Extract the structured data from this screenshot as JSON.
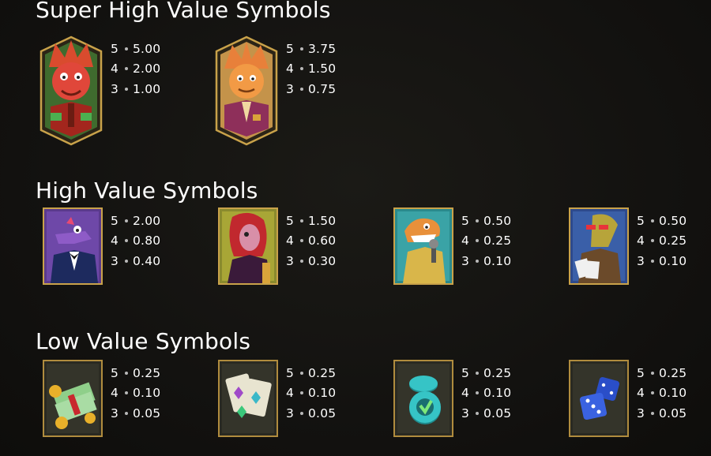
{
  "sections": {
    "super_high": {
      "title": "Super High Value Symbols",
      "symbols": [
        {
          "art": "red-triceratops-boss-symbol",
          "pays": [
            {
              "count": "5",
              "value": "5.00"
            },
            {
              "count": "4",
              "value": "2.00"
            },
            {
              "count": "3",
              "value": "1.00"
            }
          ]
        },
        {
          "art": "orange-triceratops-suit-symbol",
          "pays": [
            {
              "count": "5",
              "value": "3.75"
            },
            {
              "count": "4",
              "value": "1.50"
            },
            {
              "count": "3",
              "value": "0.75"
            }
          ]
        }
      ]
    },
    "high": {
      "title": "High Value Symbols",
      "symbols": [
        {
          "art": "purple-crocodile-tuxedo-symbol",
          "pays": [
            {
              "count": "5",
              "value": "2.00"
            },
            {
              "count": "4",
              "value": "0.80"
            },
            {
              "count": "3",
              "value": "0.40"
            }
          ]
        },
        {
          "art": "redhead-lady-dino-symbol",
          "pays": [
            {
              "count": "5",
              "value": "1.50"
            },
            {
              "count": "4",
              "value": "0.60"
            },
            {
              "count": "3",
              "value": "0.30"
            }
          ]
        },
        {
          "art": "singer-dino-microphone-symbol",
          "pays": [
            {
              "count": "5",
              "value": "0.50"
            },
            {
              "count": "4",
              "value": "0.25"
            },
            {
              "count": "3",
              "value": "0.10"
            }
          ]
        },
        {
          "art": "green-dino-cards-symbol",
          "pays": [
            {
              "count": "5",
              "value": "0.50"
            },
            {
              "count": "4",
              "value": "0.25"
            },
            {
              "count": "3",
              "value": "0.10"
            }
          ]
        }
      ]
    },
    "low": {
      "title": "Low Value Symbols",
      "symbols": [
        {
          "art": "cash-coins-symbol",
          "pays": [
            {
              "count": "5",
              "value": "0.25"
            },
            {
              "count": "4",
              "value": "0.10"
            },
            {
              "count": "3",
              "value": "0.05"
            }
          ]
        },
        {
          "art": "playing-cards-symbol",
          "pays": [
            {
              "count": "5",
              "value": "0.25"
            },
            {
              "count": "4",
              "value": "0.10"
            },
            {
              "count": "3",
              "value": "0.05"
            }
          ]
        },
        {
          "art": "casino-chips-symbol",
          "pays": [
            {
              "count": "5",
              "value": "0.25"
            },
            {
              "count": "4",
              "value": "0.10"
            },
            {
              "count": "3",
              "value": "0.05"
            }
          ]
        },
        {
          "art": "blue-dice-symbol",
          "pays": [
            {
              "count": "5",
              "value": "0.25"
            },
            {
              "count": "4",
              "value": "0.10"
            },
            {
              "count": "3",
              "value": "0.05"
            }
          ]
        }
      ]
    }
  },
  "colors": {
    "background": "#131210",
    "frame_gold": "#c9a24a",
    "dot": "#b9b9b9"
  }
}
